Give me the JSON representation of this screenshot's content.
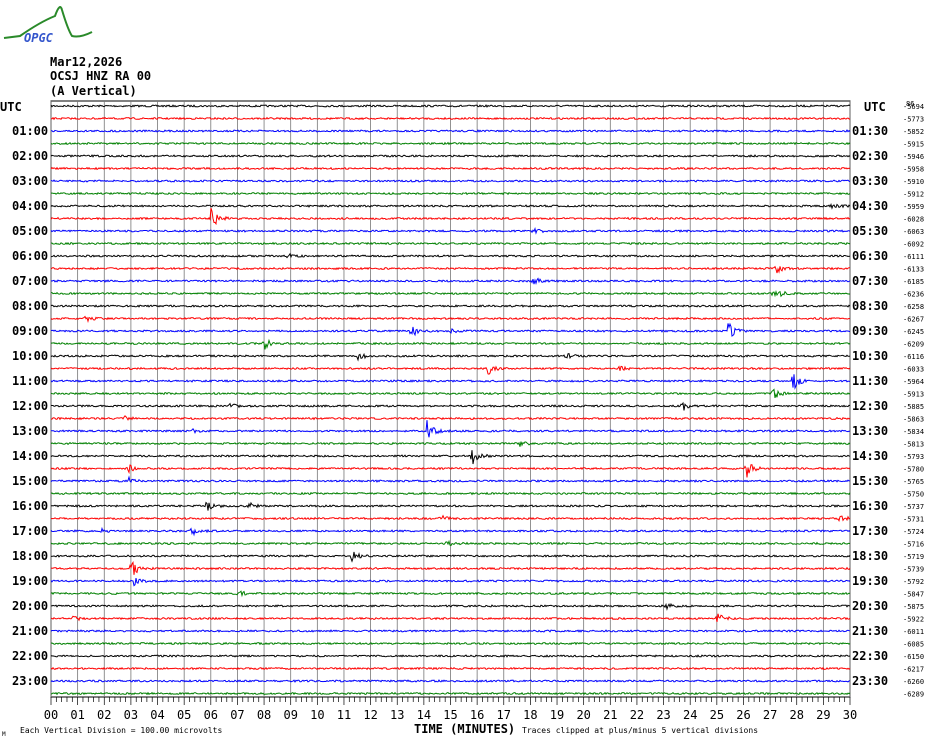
{
  "logo_text": "OPGC",
  "header": {
    "date": "Mar12,2026",
    "station": "OCSJ HNZ RA 00",
    "component": "(A Vertical)"
  },
  "footer": {
    "scale_note": "Each Vertical Division =  100.00 microvolts",
    "clip_note": "Traces clipped at plus/minus 5 vertical divisions",
    "corner_mark": "M"
  },
  "chart_data": {
    "type": "line",
    "title": "Mar12,2026 OCSJ HNZ RA 00 (A Vertical)",
    "xlabel": "TIME (MINUTES)",
    "xlim": [
      0,
      30
    ],
    "x_ticks": [
      "00",
      "01",
      "02",
      "03",
      "04",
      "05",
      "06",
      "07",
      "08",
      "09",
      "10",
      "11",
      "12",
      "13",
      "14",
      "15",
      "16",
      "17",
      "18",
      "19",
      "20",
      "21",
      "22",
      "23",
      "24",
      "25",
      "26",
      "27",
      "28",
      "29",
      "30"
    ],
    "left_label_header": "UTC",
    "right_label_header": "UTC",
    "left_labels": [
      "01:00",
      "02:00",
      "03:00",
      "04:00",
      "05:00",
      "06:00",
      "07:00",
      "08:00",
      "09:00",
      "10:00",
      "11:00",
      "12:00",
      "13:00",
      "14:00",
      "15:00",
      "16:00",
      "17:00",
      "18:00",
      "19:00",
      "20:00",
      "21:00",
      "22:00",
      "23:00"
    ],
    "right_labels": [
      "01:30",
      "02:30",
      "03:30",
      "04:30",
      "05:30",
      "06:30",
      "07:30",
      "08:30",
      "09:30",
      "10:30",
      "11:30",
      "12:30",
      "13:30",
      "14:30",
      "15:30",
      "16:30",
      "17:30",
      "18:30",
      "19:30",
      "20:30",
      "21:30",
      "22:30",
      "23:30"
    ],
    "trace_colors": [
      "#000000",
      "#ff0000",
      "#0000ff",
      "#008000"
    ],
    "trace_minutes": 30,
    "trace_count": 48,
    "overlap_top_label": "86",
    "trace_offsets": [
      "-5694",
      "-5773",
      "-5852",
      "-5915",
      "-5946",
      "-5958",
      "-5910",
      "-5912",
      "-5959",
      "-6028",
      "-6063",
      "-6092",
      "-6111",
      "-6133",
      "-6185",
      "-6236",
      "-6258",
      "-6267",
      "-6245",
      "-6209",
      "-6116",
      "-6033",
      "-5964",
      "-5913",
      "-5885",
      "-5863",
      "-5834",
      "-5813",
      "-5793",
      "-5780",
      "-5765",
      "-5750",
      "-5737",
      "-5731",
      "-5724",
      "-5716",
      "-5719",
      "-5739",
      "-5792",
      "-5847",
      "-5875",
      "-5922",
      "-6011",
      "-6085",
      "-6150",
      "-6217",
      "-6260",
      "-6289"
    ],
    "clip_divisions": 5,
    "events": [
      {
        "trace": 9,
        "minute": 6.0,
        "amp": 5
      },
      {
        "trace": 18,
        "minute": 13.5,
        "amp": 4
      },
      {
        "trace": 26,
        "minute": 14.1,
        "amp": 5
      },
      {
        "trace": 28,
        "minute": 15.8,
        "amp": 4
      },
      {
        "trace": 29,
        "minute": 26.1,
        "amp": 4
      },
      {
        "trace": 22,
        "minute": 27.8,
        "amp": 5
      },
      {
        "trace": 18,
        "minute": 25.4,
        "amp": 4
      },
      {
        "trace": 19,
        "minute": 8.0,
        "amp": 2.5
      },
      {
        "trace": 37,
        "minute": 3.0,
        "amp": 4
      },
      {
        "trace": 29,
        "minute": 2.9,
        "amp": 2
      },
      {
        "trace": 32,
        "minute": 5.8,
        "amp": 3
      },
      {
        "trace": 21,
        "minute": 16.4,
        "amp": 2.5
      },
      {
        "trace": 8,
        "minute": 29.3,
        "amp": 1.5
      },
      {
        "trace": 41,
        "minute": 25.0,
        "amp": 3
      },
      {
        "trace": 33,
        "minute": 29.6,
        "amp": 2
      },
      {
        "trace": 24,
        "minute": 23.7,
        "amp": 2
      },
      {
        "trace": 23,
        "minute": 27.1,
        "amp": 3
      },
      {
        "trace": 15,
        "minute": 27.1,
        "amp": 4
      },
      {
        "trace": 20,
        "minute": 11.5,
        "amp": 2
      },
      {
        "trace": 36,
        "minute": 11.3,
        "amp": 2
      },
      {
        "trace": 34,
        "minute": 5.3,
        "amp": 2
      },
      {
        "trace": 41,
        "minute": 0.8,
        "amp": 1.5
      },
      {
        "trace": 13,
        "minute": 27.2,
        "amp": 2
      },
      {
        "trace": 12,
        "minute": 8.9,
        "amp": 1
      },
      {
        "trace": 10,
        "minute": 18.1,
        "amp": 1.5
      },
      {
        "trace": 14,
        "minute": 18.1,
        "amp": 2
      },
      {
        "trace": 20,
        "minute": 19.3,
        "amp": 1.5
      },
      {
        "trace": 24,
        "minute": 6.7,
        "amp": 1
      },
      {
        "trace": 30,
        "minute": 2.9,
        "amp": 1.5
      },
      {
        "trace": 33,
        "minute": 14.6,
        "amp": 1.5
      },
      {
        "trace": 35,
        "minute": 14.8,
        "amp": 1.5
      },
      {
        "trace": 38,
        "minute": 3.1,
        "amp": 2
      },
      {
        "trace": 39,
        "minute": 7.0,
        "amp": 1.5
      },
      {
        "trace": 40,
        "minute": 23.1,
        "amp": 1
      },
      {
        "trace": 32,
        "minute": 7.4,
        "amp": 1.5
      },
      {
        "trace": 34,
        "minute": 1.9,
        "amp": 1
      },
      {
        "trace": 25,
        "minute": 2.7,
        "amp": 1.5
      },
      {
        "trace": 26,
        "minute": 5.3,
        "amp": 1
      },
      {
        "trace": 27,
        "minute": 17.6,
        "amp": 1
      },
      {
        "trace": 17,
        "minute": 1.3,
        "amp": 1.5
      },
      {
        "trace": 18,
        "minute": 15.0,
        "amp": 1
      },
      {
        "trace": 21,
        "minute": 21.3,
        "amp": 1
      }
    ]
  }
}
